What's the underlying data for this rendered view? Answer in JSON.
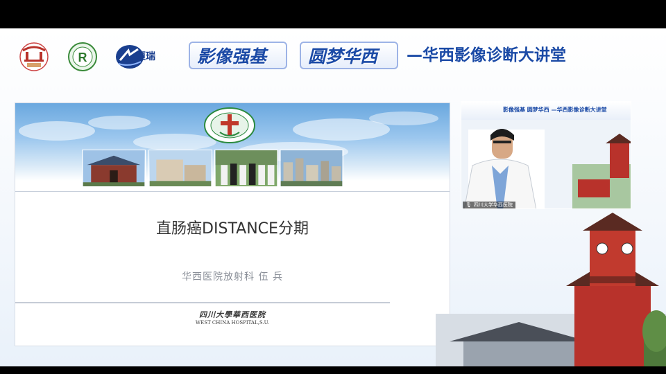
{
  "header": {
    "logo_hr_text": "恒瑞",
    "tag1": "影像强基",
    "tag2": "圆梦华西",
    "title": "—华西影像诊断大讲堂"
  },
  "slide": {
    "title": "直肠癌DISTANCE分期",
    "subtitle": "华西医院放射科    伍 兵",
    "footer_cn": "四川大學華西医院",
    "footer_en": "WEST CHINA HOSPITAL,S.U."
  },
  "webcam": {
    "banner": "影像强基  圆梦华西 —华西影像诊断大讲堂",
    "label": "四川大学华西医院"
  },
  "colors": {
    "brand_blue": "#1b4aa6",
    "hospital_red": "#b8322b"
  },
  "icons": {
    "mic": "microphone-icon"
  }
}
